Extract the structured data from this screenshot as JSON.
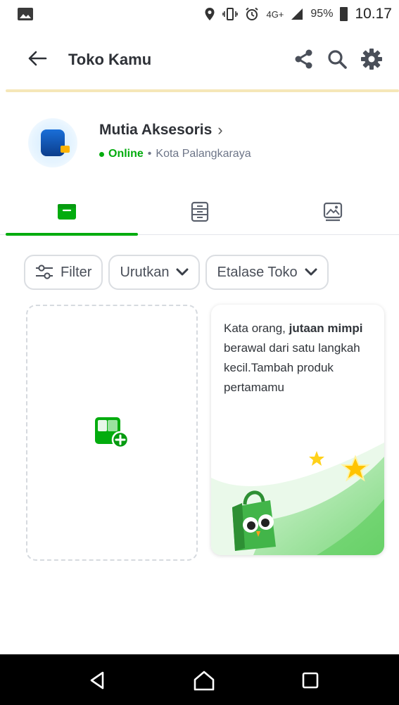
{
  "status_bar": {
    "network": "4G+",
    "battery": "95%",
    "time": "10.17",
    "icons": [
      "image-icon",
      "location-icon",
      "vibrate-icon",
      "alarm-icon",
      "signal-icon",
      "battery-icon"
    ]
  },
  "app_bar": {
    "title": "Toko Kamu",
    "icons": [
      "back-arrow-icon",
      "share-icon",
      "search-icon",
      "gear-icon"
    ]
  },
  "shop": {
    "name": "Mutia Aksesoris",
    "chevron": "›",
    "status": "Online",
    "separator": "•",
    "location": "Kota Palangkaraya"
  },
  "tabs": [
    {
      "icon": "storefront-icon",
      "active": true
    },
    {
      "icon": "catalog-list-icon",
      "active": false
    },
    {
      "icon": "gallery-icon",
      "active": false
    }
  ],
  "filters": {
    "filter_label": "Filter",
    "sort_label": "Urutkan",
    "showcase_label": "Etalase Toko"
  },
  "promo": {
    "text_1": "Kata orang, ",
    "text_bold_1": "jutaan mimpi",
    "text_2": " berawal dari satu langkah kecil.Tambah produk pertamamu"
  },
  "colors": {
    "accent": "#03AC0E",
    "divider_yellow": "#F5E7B8",
    "text_primary": "#2E3137",
    "text_secondary": "#6D7588",
    "nav_bar": "#000000"
  },
  "nav": [
    "back-triangle-icon",
    "home-icon",
    "recents-icon"
  ]
}
